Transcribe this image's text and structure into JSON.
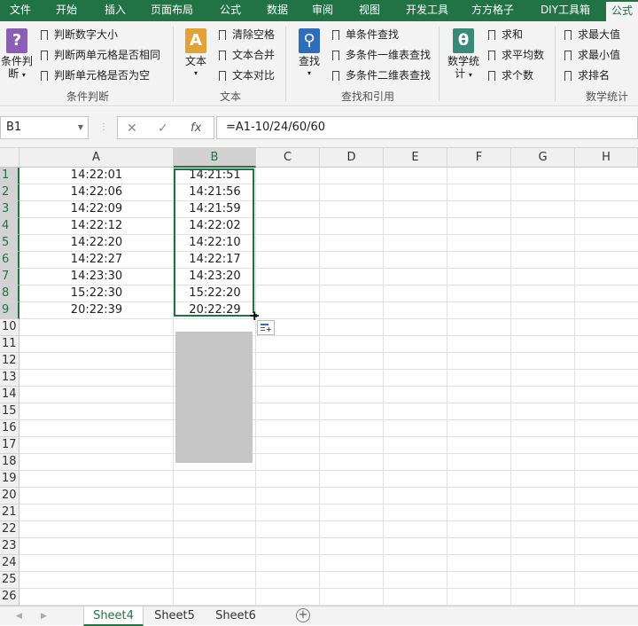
{
  "ribbon_tabs": [
    {
      "label": "文件",
      "active": false
    },
    {
      "label": "开始",
      "active": false
    },
    {
      "label": "插入",
      "active": false
    },
    {
      "label": "页面布局",
      "active": false
    },
    {
      "label": "公式",
      "active": false
    },
    {
      "label": "数据",
      "active": false
    },
    {
      "label": "审阅",
      "active": false
    },
    {
      "label": "视图",
      "active": false
    },
    {
      "label": "开发工具",
      "active": false
    },
    {
      "label": "方方格子",
      "active": false
    },
    {
      "label": "DIY工具箱",
      "active": false
    },
    {
      "label": "公式",
      "active": true
    }
  ],
  "ribbon": {
    "g1": {
      "big_l1": "条件判",
      "big_l2": "断",
      "items": [
        "判断数字大小",
        "判断两单元格是否相同",
        "判断单元格是否为空"
      ],
      "label": "条件判断"
    },
    "g2": {
      "big_l1": "文本",
      "items": [
        "清除空格",
        "文本合并",
        "文本对比"
      ],
      "label": "文本"
    },
    "g3": {
      "big_l1": "查找",
      "items": [
        "单条件查找",
        "多条件一维表查找",
        "多条件二维表查找"
      ],
      "label": "查找和引用"
    },
    "g4": {
      "big_l1": "数学统",
      "big_l2": "计",
      "items": [
        "求和",
        "求平均数",
        "求个数"
      ],
      "label": "数学统计"
    },
    "g5": {
      "items": [
        "求最大值",
        "求最小值",
        "求排名"
      ]
    }
  },
  "icon_colors": {
    "question": "#8a5fb5",
    "text": "#e3a13a",
    "search": "#2e6db8",
    "theta": "#3a8a7a"
  },
  "formula_bar": {
    "name_box": "B1",
    "cancel": "✕",
    "enter": "✓",
    "fx": "fx",
    "formula": "=A1-10/24/60/60"
  },
  "columns": [
    "A",
    "B",
    "C",
    "D",
    "E",
    "F",
    "G",
    "H"
  ],
  "rows": [
    "1",
    "2",
    "3",
    "4",
    "5",
    "6",
    "7",
    "8",
    "9",
    "10",
    "11",
    "12",
    "13",
    "14",
    "15",
    "16",
    "17",
    "18",
    "19",
    "20",
    "21",
    "22",
    "23",
    "24",
    "25",
    "26"
  ],
  "col_a": [
    "14:22:01",
    "14:22:06",
    "14:22:09",
    "14:22:12",
    "14:22:20",
    "14:22:27",
    "14:23:30",
    "15:22:30",
    "20:22:39"
  ],
  "col_b": [
    "14:21:51",
    "14:21:56",
    "14:21:59",
    "14:22:02",
    "14:22:10",
    "14:22:17",
    "14:23:20",
    "15:22:20",
    "20:22:29"
  ],
  "sheets": [
    {
      "label": "Sheet4",
      "active": true
    },
    {
      "label": "Sheet5",
      "active": false
    },
    {
      "label": "Sheet6",
      "active": false
    }
  ],
  "add_sheet": "+",
  "accent": "#217346"
}
